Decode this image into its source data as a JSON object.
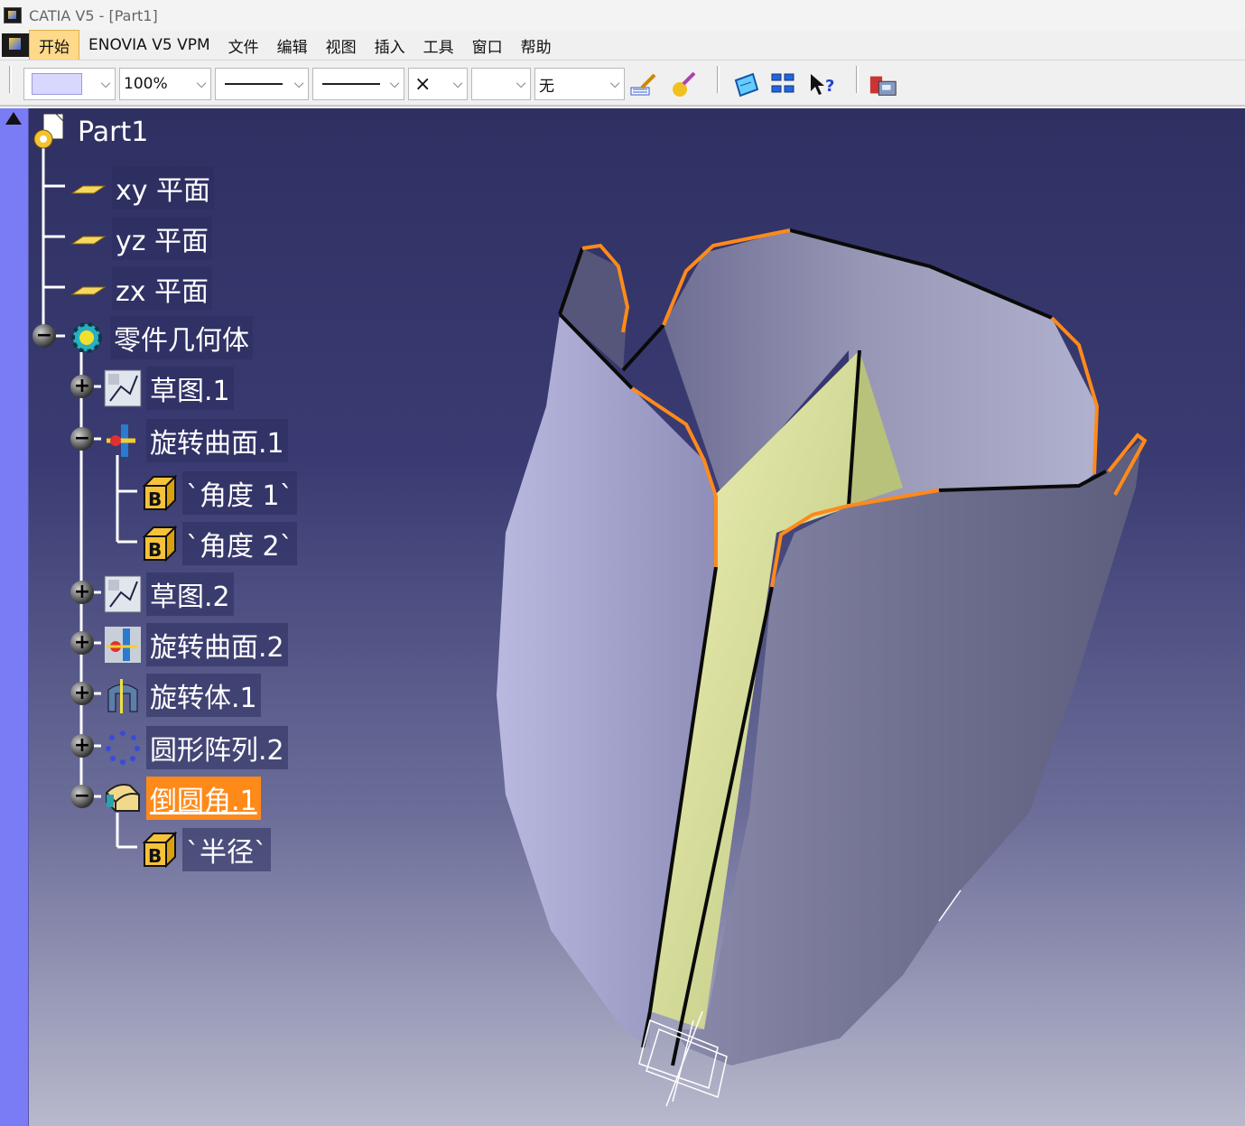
{
  "window": {
    "title": "CATIA V5 - [Part1]"
  },
  "menubar": {
    "items": [
      "开始",
      "ENOVIA V5 VPM",
      "文件",
      "编辑",
      "视图",
      "插入",
      "工具",
      "窗口",
      "帮助"
    ]
  },
  "toolbar": {
    "color_combo": "",
    "transparency_combo": "100%",
    "linetype_combo": "",
    "linewidth_combo": "",
    "point_combo": "×",
    "layer_combo": "",
    "layer_value": "无"
  },
  "tree": {
    "root": "Part1",
    "planes": [
      "xy 平面",
      "yz 平面",
      "zx 平面"
    ],
    "body": "零件几何体",
    "features": {
      "sketch1": "草图.1",
      "revolve_surface1": "旋转曲面.1",
      "angle1": "`角度 1`",
      "angle2": "`角度 2`",
      "sketch2": "草图.2",
      "revolve_surface2": "旋转曲面.2",
      "shaft1": "旋转体.1",
      "circpattern2": "圆形阵列.2",
      "fillet1": "倒圆角.1",
      "radius": "`半径`"
    }
  },
  "colors": {
    "selection": "#ff8a1a",
    "compass_strip": "#7a7cf6",
    "background_top": "#2f3062",
    "background_bottom": "#b8b9cc",
    "surface": "#a9a9d6",
    "inner_face": "#d9e29a"
  },
  "icons": [
    "catia-app-icon",
    "brush-icon",
    "paint-icon",
    "swap-visible-space-icon",
    "hide-show-icon",
    "whats-this-icon",
    "catalog-icon"
  ]
}
